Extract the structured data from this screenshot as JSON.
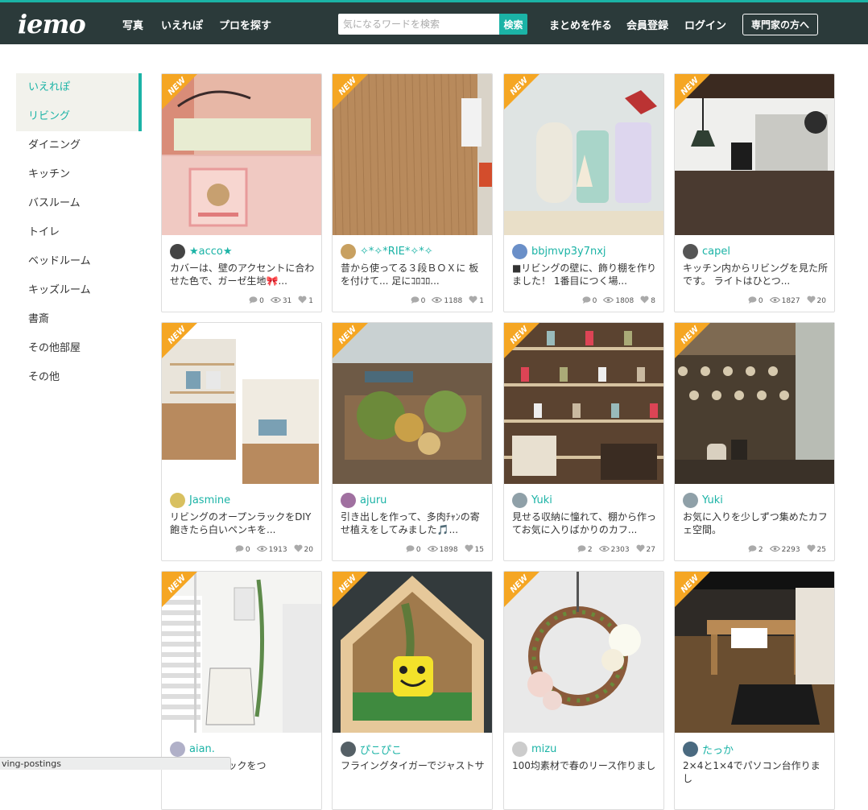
{
  "header": {
    "logo": "iemo",
    "nav": [
      "写真",
      "いえれぽ",
      "プロを探す"
    ],
    "search_placeholder": "気になるワードを検索",
    "search_button": "検索",
    "links": [
      "まとめを作る",
      "会員登録",
      "ログイン"
    ],
    "pro_button": "専門家の方へ"
  },
  "sidebar": {
    "items": [
      {
        "label": "いえれぽ",
        "active": true
      },
      {
        "label": "リビング",
        "active": true
      },
      {
        "label": "ダイニング",
        "active": false
      },
      {
        "label": "キッチン",
        "active": false
      },
      {
        "label": "バスルーム",
        "active": false
      },
      {
        "label": "トイレ",
        "active": false
      },
      {
        "label": "ベッドルーム",
        "active": false
      },
      {
        "label": "キッズルーム",
        "active": false
      },
      {
        "label": "書斎",
        "active": false
      },
      {
        "label": "その他部屋",
        "active": false
      },
      {
        "label": "その他",
        "active": false
      }
    ]
  },
  "badge": "NEW",
  "cards": [
    {
      "user": "★acco★",
      "desc": "カバーは、壁のアクセントに合わせた色で、ガーゼ生地🎀...",
      "comments": "0",
      "views": "31",
      "likes": "1",
      "photo": "bed",
      "avatar": "#444444"
    },
    {
      "user": "✧*✧*RIE*✧*✧",
      "desc": "昔から使ってる３段ＢＯＸに 板を付けて... 足にｺﾛｺﾛ...",
      "comments": "0",
      "views": "1188",
      "likes": "1",
      "photo": "box",
      "avatar": "#c8a060"
    },
    {
      "user": "bbjmvp3y7nxj",
      "desc": "■リビングの壁に、飾り棚を作りました！ 1番目につく場...",
      "comments": "0",
      "views": "1808",
      "likes": "8",
      "photo": "shelf",
      "avatar": "#6a8fc8"
    },
    {
      "user": "capel",
      "desc": "キッチン内からリビングを見た所です。 ライトはひとつ...",
      "comments": "0",
      "views": "1827",
      "likes": "20",
      "photo": "room",
      "avatar": "#555555"
    },
    {
      "user": "Jasmine",
      "desc": "リビングのオープンラックをDIY 飽きたら白いペンキを...",
      "comments": "0",
      "views": "1913",
      "likes": "20",
      "photo": "rack",
      "avatar": "#d8c060"
    },
    {
      "user": "ajuru",
      "desc": "引き出しを作って、多肉ﾁｬﾝの寄せ植えをしてみました🎵...",
      "comments": "0",
      "views": "1898",
      "likes": "15",
      "photo": "plants",
      "avatar": "#a070a0"
    },
    {
      "user": "Yuki",
      "desc": "見せる収納に憧れて、棚から作ってお気に入りばかりのカフ...",
      "comments": "2",
      "views": "2303",
      "likes": "27",
      "photo": "kitchen",
      "avatar": "#8fa0a8"
    },
    {
      "user": "Yuki",
      "desc": "お気に入りを少しずつ集めたカフェ空間。",
      "comments": "2",
      "views": "2293",
      "likes": "25",
      "photo": "cafe",
      "avatar": "#8fa0a8"
    },
    {
      "user": "aian.",
      "desc": "...セリアのフックをつ",
      "comments": "",
      "views": "",
      "likes": "",
      "photo": "wall",
      "avatar": "#b0b0c8"
    },
    {
      "user": "ぴこぴこ",
      "desc": "フライングタイガーでジャストサ",
      "comments": "",
      "views": "",
      "likes": "",
      "photo": "house",
      "avatar": "#556066"
    },
    {
      "user": "mizu",
      "desc": "100均素材で春のリース作りまし",
      "comments": "",
      "views": "",
      "likes": "",
      "photo": "wreath",
      "avatar": "#cccccc"
    },
    {
      "user": "たっか",
      "desc": "2×4と1×4でパソコン台作りまし",
      "comments": "",
      "views": "",
      "likes": "",
      "photo": "desk",
      "avatar": "#4a6a80"
    }
  ],
  "statusbar": "ving-postings"
}
